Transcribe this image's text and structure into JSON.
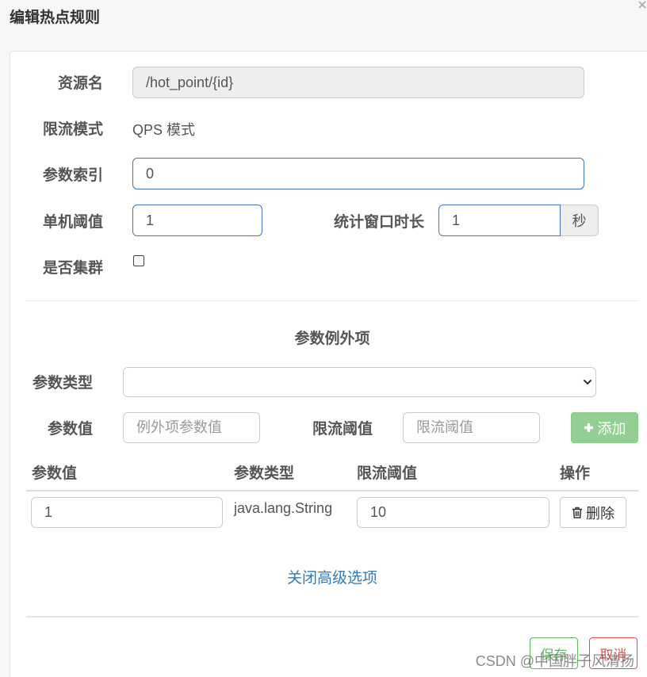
{
  "dialog": {
    "title": "编辑热点规则"
  },
  "form": {
    "resource": {
      "label": "资源名",
      "value": "/hot_point/{id}"
    },
    "mode": {
      "label": "限流模式",
      "value": "QPS 模式"
    },
    "param_index": {
      "label": "参数索引",
      "value": "0"
    },
    "threshold": {
      "label": "单机阈值",
      "value": "1"
    },
    "window": {
      "label": "统计窗口时长",
      "value": "1",
      "unit": "秒"
    },
    "cluster": {
      "label": "是否集群",
      "checked": false
    }
  },
  "exceptions": {
    "heading": "参数例外项",
    "type_label": "参数类型",
    "value_label": "参数值",
    "value_placeholder": "例外项参数值",
    "limit_label": "限流阈值",
    "limit_placeholder": "限流阈值",
    "add_label": "添加",
    "table": {
      "headers": [
        "参数值",
        "参数类型",
        "限流阈值",
        "操作"
      ],
      "rows": [
        {
          "value": "1",
          "type": "java.lang.String",
          "limit": "10",
          "delete_label": "删除"
        }
      ]
    }
  },
  "advanced_toggle": "关闭高级选项",
  "footer": {
    "save_label": "保存",
    "cancel_label": "取消"
  },
  "watermark": "CSDN @中国胖子风清扬",
  "icons": {
    "close": "close-icon",
    "select": "chevron-down-icon",
    "add": "plus-icon",
    "delete": "trash-icon"
  },
  "colors": {
    "link": "#337ab7",
    "success": "#5cb85c",
    "danger": "#d9534f",
    "add_button_bg": "#93cf93",
    "focus_border": "#4677b3"
  }
}
